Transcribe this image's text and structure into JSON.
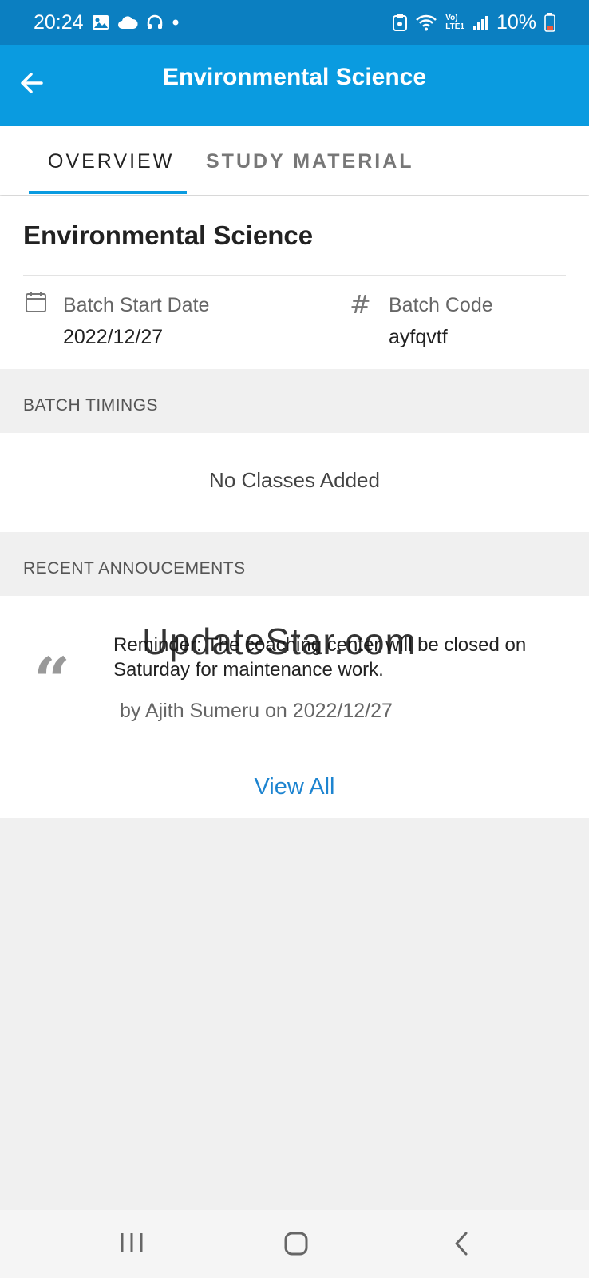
{
  "status_bar": {
    "time": "20:24",
    "battery": "10%",
    "icons": [
      "image-icon",
      "cloud-icon",
      "headset-icon",
      "dot-icon",
      "save-icon",
      "wifi-icon",
      "volte-icon",
      "signal-icon",
      "battery-icon"
    ],
    "network_label_top": "Vo)",
    "network_label_bottom": "LTE1"
  },
  "app_bar": {
    "title": "Environmental Science",
    "back_icon": "arrow-left-icon"
  },
  "tabs": [
    {
      "label": "OVERVIEW",
      "active": true
    },
    {
      "label": "STUDY MATERIAL",
      "active": false
    }
  ],
  "overview": {
    "course_title": "Environmental Science",
    "batch_start_label": "Batch Start Date",
    "batch_start_value": "2022/12/27",
    "batch_code_label": "Batch Code",
    "batch_code_value": "ayfqvtf",
    "hash_symbol": "#"
  },
  "batch_timings": {
    "header": "BATCH TIMINGS",
    "empty_text": "No Classes Added"
  },
  "announcements": {
    "header": "RECENT ANNOUCEMENTS",
    "items": [
      {
        "text": "Reminder: The coaching center will be closed on Saturday for maintenance work.",
        "meta": "by Ajith Sumeru on 2022/12/27"
      }
    ],
    "quote_symbol": "“",
    "view_all": "View All"
  },
  "watermark": "UpdateStar.com",
  "colors": {
    "status_bar": "#0b7fc1",
    "app_bar": "#0a9be0",
    "accent": "#1d84d0",
    "background": "#f0f0f0"
  }
}
